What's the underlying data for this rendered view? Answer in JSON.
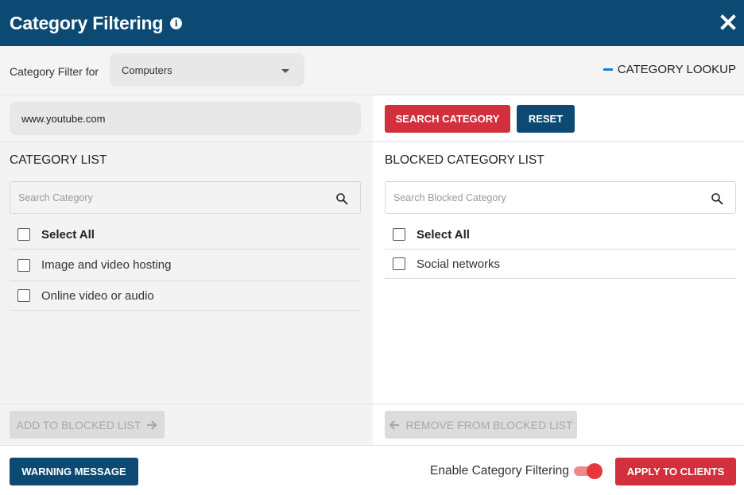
{
  "header": {
    "title": "Category Filtering",
    "info_icon": "info-icon",
    "close_icon": "close-icon"
  },
  "filter": {
    "label": "Category Filter for",
    "selected": "Computers",
    "lookup_label": "CATEGORY LOOKUP"
  },
  "search": {
    "url_value": "www.youtube.com",
    "search_button": "SEARCH CATEGORY",
    "reset_button": "RESET"
  },
  "category_list": {
    "title": "CATEGORY LIST",
    "search_placeholder": "Search Category",
    "select_all": "Select All",
    "items": [
      {
        "label": "Image and video hosting",
        "checked": false
      },
      {
        "label": "Online video or audio",
        "checked": false
      }
    ],
    "add_button": "ADD TO BLOCKED LIST"
  },
  "blocked_list": {
    "title": "BLOCKED CATEGORY LIST",
    "search_placeholder": "Search Blocked Category",
    "select_all": "Select All",
    "items": [
      {
        "label": "Social networks",
        "checked": false
      }
    ],
    "remove_button": "REMOVE FROM BLOCKED LIST"
  },
  "footer": {
    "warning_button": "WARNING MESSAGE",
    "enable_label": "Enable Category Filtering",
    "enable_on": true,
    "apply_button": "APPLY TO CLIENTS"
  },
  "colors": {
    "brand_navy": "#0d4a73",
    "action_red": "#d1303c",
    "accent_blue": "#1a7bd0"
  }
}
